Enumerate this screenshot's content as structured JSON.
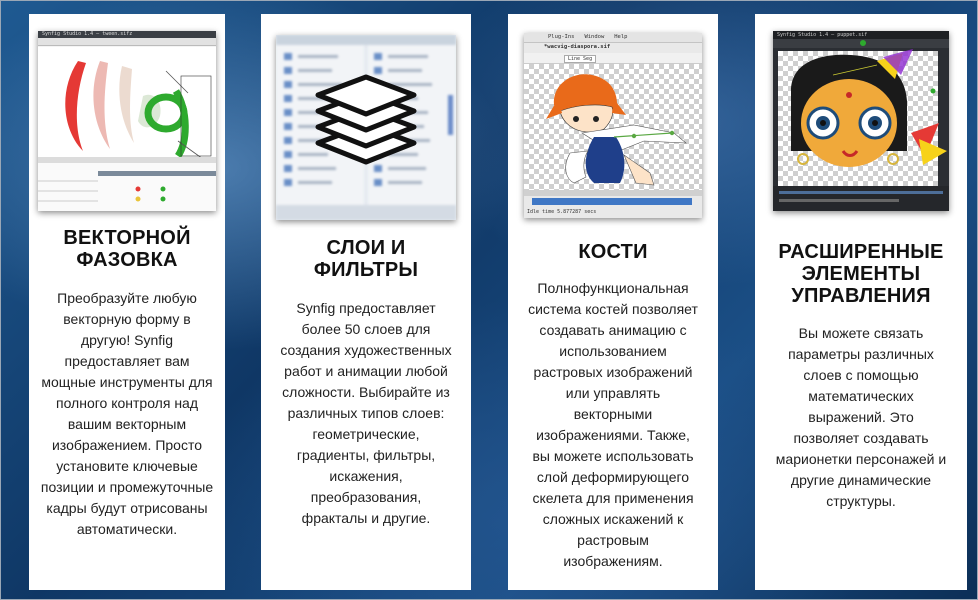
{
  "cards": [
    {
      "title_lines": [
        "ВЕКТОРНОЙ",
        "ФАЗОВКА"
      ],
      "text_lines": [
        "Преобразуйте любую",
        "векторную форму в",
        "другую! Synfig",
        "предоставляет вам",
        "мощные инструменты для",
        "полного контроля над",
        "вашим векторным",
        "изображением. Просто",
        "установите ключевые",
        "позиции и промежуточные",
        "кадры будут отрисованы",
        "автоматически."
      ],
      "image": "synfig-vector-tweening-screenshot"
    },
    {
      "title_lines": [
        "СЛОИ И",
        "ФИЛЬТРЫ"
      ],
      "text_lines": [
        "Synfig предоставляет",
        "более 50 слоев для",
        "создания художественных",
        "работ и анимации любой",
        "сложности. Выбирайте из",
        "различных типов слоев:",
        "геометрические,",
        "градиенты, фильтры,",
        "искажения,",
        "преобразования,",
        "фракталы и другие."
      ],
      "image": "layers-stack-icon"
    },
    {
      "title_lines": [
        "КОСТИ"
      ],
      "text_lines": [
        "Полнофункциональная",
        "система костей позволяет",
        "создавать анимацию с",
        "использованием",
        "растровых изображений",
        "или управлять",
        "векторными",
        "изображениями. Также,",
        "вы можете использовать",
        "слой деформирующего",
        "скелета для применения",
        "сложных искажений к",
        "растровым",
        "изображениям."
      ],
      "image": "synfig-bones-screenshot"
    },
    {
      "title_lines": [
        "РАСШИРЕННЫЕ",
        "ЭЛЕМЕНТЫ",
        "УПРАВЛЕНИЯ"
      ],
      "text_lines": [
        "Вы можете связать",
        "параметры различных",
        "слоев с помощью",
        "математических",
        "выражений. Это",
        "позволяет создавать",
        "марионетки персонажей и",
        "другие динамические",
        "структуры."
      ],
      "image": "synfig-puppet-screenshot"
    }
  ],
  "thumb_labels": {
    "card1_titlebar": "Synfig Studio 1.4 — tween.sifz",
    "card3_menu": [
      "Plug-Ins",
      "Window",
      "Help"
    ],
    "card3_tab": "*wacvig-diaspora.sif",
    "card3_tool": "Line Seg",
    "card3_status": "Idle time 5.877287 secs",
    "card4_titlebar": "Synfig Studio 1.4 — puppet.sif"
  },
  "colors": {
    "background": "#123f6e",
    "card": "#ffffff",
    "title": "#111111",
    "text": "#222222"
  }
}
